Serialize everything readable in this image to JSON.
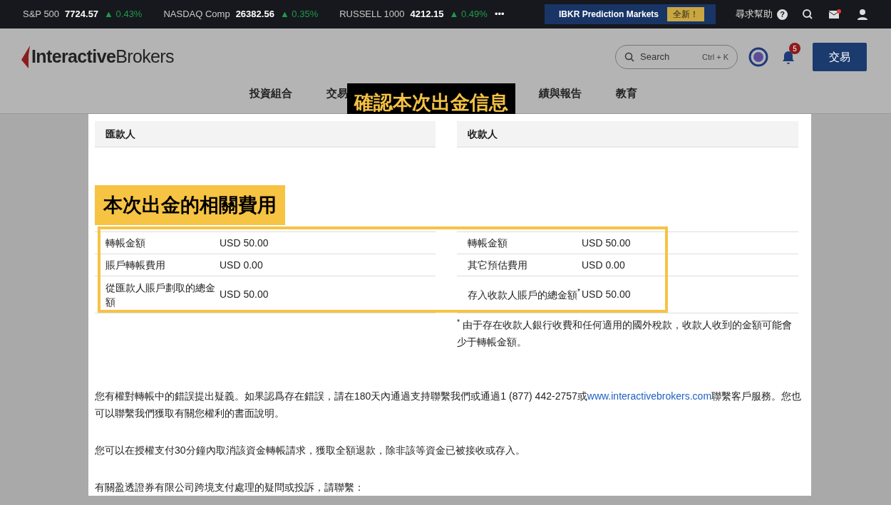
{
  "ticker": [
    {
      "name": "S&P 500",
      "value": "7724.57",
      "change": "▲ 0.43%"
    },
    {
      "name": "NASDAQ Comp",
      "value": "26382.56",
      "change": "▲ 0.35%"
    },
    {
      "name": "RUSSELL 1000",
      "value": "4212.15",
      "change": "▲ 0.49%"
    }
  ],
  "ticker_more": "•••",
  "promo": {
    "label": "IBKR Prediction Markets",
    "badge": "全新！"
  },
  "help": "尋求幫助",
  "help_icon": "?",
  "brand": {
    "bold": "Interactive",
    "light": "Brokers"
  },
  "search": {
    "placeholder": "Search",
    "shortcut": "Ctrl + K"
  },
  "notifications": "5",
  "trade_button": "交易",
  "nav": [
    "投資組合",
    "交易",
    "績與報告",
    "教育"
  ],
  "annotations": {
    "title": "確認本次出金信息",
    "fees": "本次出金的相關費用"
  },
  "sender": {
    "heading": "匯款人",
    "rows": [
      {
        "label": "轉帳金額",
        "value": "USD 50.00"
      },
      {
        "label": "賬戶轉帳費用",
        "value": "USD 0.00"
      },
      {
        "label": "從匯款人賬戶劃取的總金額",
        "value": "USD 50.00"
      }
    ]
  },
  "recipient": {
    "heading": "收款人",
    "rows": [
      {
        "label": "轉帳金額",
        "value": "USD 50.00"
      },
      {
        "label": "其它預估費用",
        "value": "USD 0.00"
      },
      {
        "label": "存入收款人賬戶的總金額$^{*}$",
        "value": "USD 50.00"
      }
    ],
    "footnote": "$^{*}$ 由于存在收款人銀行收費和任何適用的國外稅款，收款人收到的金額可能會少于轉帳金額。"
  },
  "dispute": {
    "before": "您有權對轉帳中的錯誤提出疑義。如果認爲存在錯誤，請在180天內通過支持聯繫我們或通過1 (877) 442-2757或",
    "link": "www.interactivebrokers.com",
    "after": "聯繫客戶服務。您也可以聯繫我們獲取有關您權利的書面說明。"
  },
  "paragraphs": [
    "您可以在授權支付30分鐘內取消該資金轉帳請求，獲取全額退款，除非該等資金已被接收或存入。",
    "有關盈透證券有限公司跨境支付處理的疑問或投訴，請聯繫："
  ]
}
